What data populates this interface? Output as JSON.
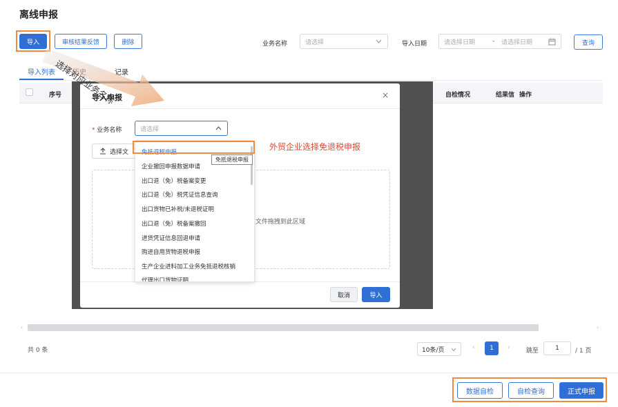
{
  "page": {
    "title": "离线申报"
  },
  "toolbar": {
    "import_label": "导入",
    "audit_feedback_label": "审核结果反馈",
    "delete_label": "删除",
    "biz_name_label": "业务名称",
    "biz_name_placeholder": "请选择",
    "import_date_label": "导入日期",
    "date_start_placeholder": "请选择日期",
    "date_sep": "-",
    "date_end_placeholder": "请选择日期",
    "query_label": "查询"
  },
  "tabs": [
    {
      "label": "导入列表"
    },
    {
      "label": "历史"
    },
    {
      "label": "记录"
    }
  ],
  "table": {
    "headers": [
      "序号",
      "自检情况",
      "结果信",
      "操作"
    ]
  },
  "arrow_annotation": "选择对应业务名称",
  "modal": {
    "title": "导入申报",
    "close": "×",
    "required_mark": "*",
    "biz_name_label": "业务名称",
    "biz_name_placeholder": "请选择",
    "upload_label": "选择文",
    "drop_text": "文件拖拽到此区域",
    "cancel_label": "取消",
    "import_label": "导入"
  },
  "dropdown": {
    "options": [
      "免抵退税申报",
      "企业撤回申报数据申请",
      "出口退（免）税备案变更",
      "出口退（免）税凭证信息查询",
      "出口货物已补税/未退税证明",
      "出口退（免）税备案撤回",
      "进货凭证信息回退申请",
      "购进自用货物退税申报",
      "生产企业进料加工业务免抵退税核销",
      "代理出口货物证明"
    ],
    "tooltip": "免抵退税申报"
  },
  "red_annotation": "外贸企业选择免退税申报",
  "pagination": {
    "total": "共 0 条",
    "page_size": "10条/页",
    "prev": "‹",
    "current": "1",
    "next": "›",
    "goto_label": "跳至",
    "goto_value": "1",
    "total_pages": "/ 1 页"
  },
  "footer": {
    "self_check_label": "数据自检",
    "self_check_query_label": "自检查询",
    "formal_submit_label": "正式申报"
  },
  "colors": {
    "primary": "#2f6fd6",
    "highlight": "#f08a3e",
    "annotation": "#e8432f"
  },
  "icons": [
    "chevron-down-icon",
    "calendar-icon",
    "upload-icon",
    "close-icon",
    "chevron-up-icon",
    "chevron-left-icon",
    "chevron-right-icon"
  ]
}
